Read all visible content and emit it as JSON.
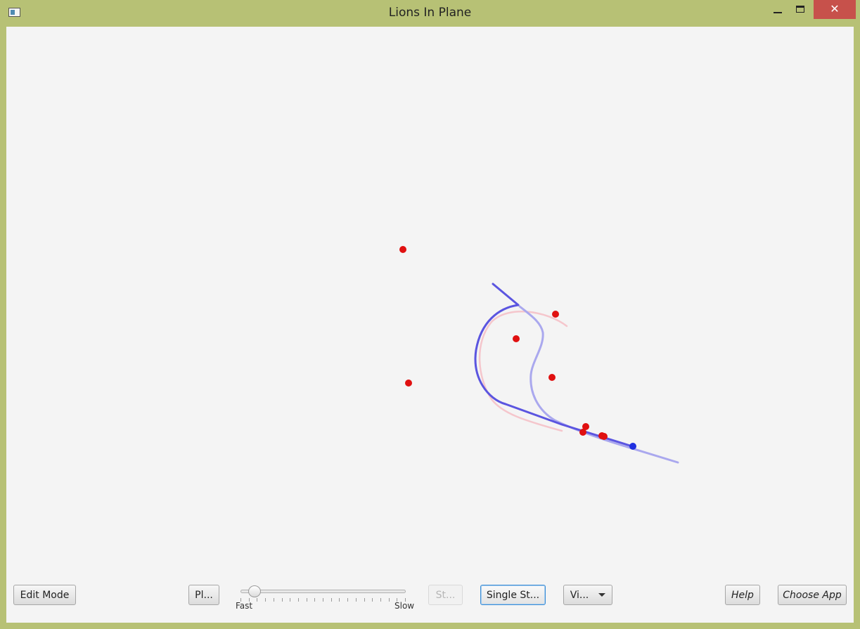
{
  "window": {
    "title": "Lions In Plane",
    "close_glyph": "✕",
    "icons": [
      "app-window-icon",
      "minimize-icon",
      "maximize-icon",
      "close-icon"
    ]
  },
  "colors": {
    "title_bar": "#b7c175",
    "canvas_bg": "#f4f4f4",
    "lion": "#e01010",
    "man": "#1f2fe0",
    "path_primary": "#5b55e0",
    "path_secondary": "#aaa8ee",
    "path_faint": "#f5c6cc",
    "close_button": "#c7514b"
  },
  "toolbar": {
    "edit_mode": "Edit Mode",
    "play": "Pl...",
    "speed_fast": "Fast",
    "speed_slow": "Slow",
    "stop": "St...",
    "single_step": "Single St...",
    "view": "Vi...",
    "help": "Help",
    "choose_app": "Choose App"
  },
  "speed_slider": {
    "value_fraction": 0.05,
    "tick_count": 21
  }
}
